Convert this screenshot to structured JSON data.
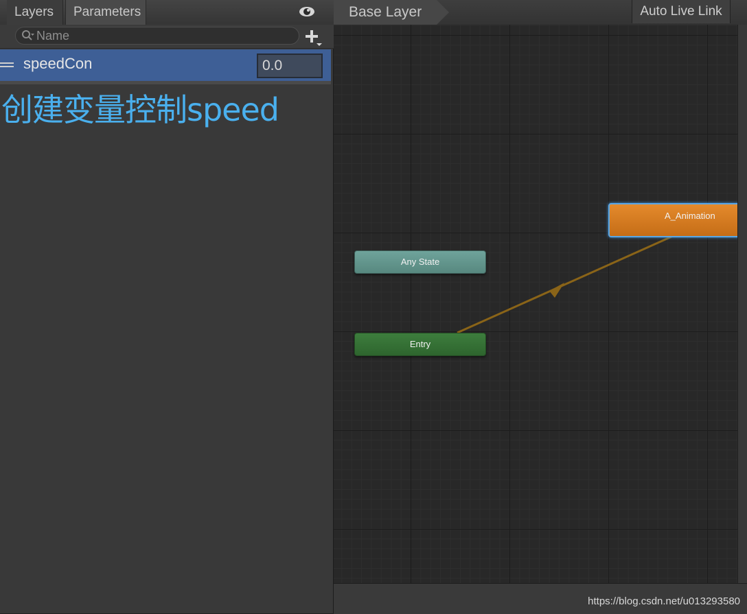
{
  "left_panel": {
    "tabs": {
      "layers": "Layers",
      "parameters": "Parameters"
    },
    "search": {
      "placeholder": "Name"
    },
    "parameter": {
      "name": "speedCon",
      "value": "0.0"
    },
    "annotation": "创建变量控制speed"
  },
  "right_panel": {
    "breadcrumb": "Base Layer",
    "auto_live_link": "Auto Live Link",
    "nodes": {
      "any_state": "Any State",
      "entry": "Entry",
      "animation": "A_Animation"
    },
    "watermark": "https://blog.csdn.net/u013293580"
  },
  "colors": {
    "selected_row": "#3e5f96",
    "annotation_text": "#4ab0ee",
    "any_state_node": "#6fa39b",
    "entry_node": "#3d7d3d",
    "animation_node": "#e48a2c",
    "transition_arrow": "#8a6418"
  }
}
